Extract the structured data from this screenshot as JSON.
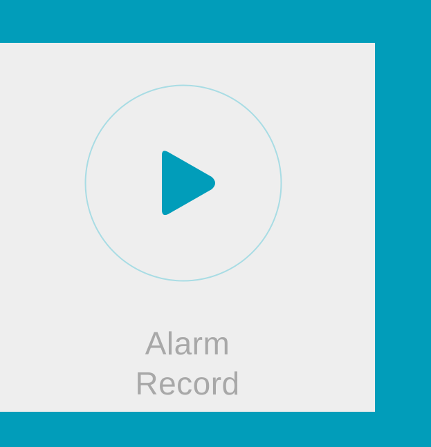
{
  "tile": {
    "label_line_1": "Alarm",
    "label_line_2": "Record",
    "icon": "play-icon"
  },
  "colors": {
    "background": "#019DBA",
    "tile_background": "#EEEEEE",
    "ring_stroke": "#A8DCE4",
    "play_fill": "#019DBA",
    "label_text": "#A8A8A8"
  }
}
